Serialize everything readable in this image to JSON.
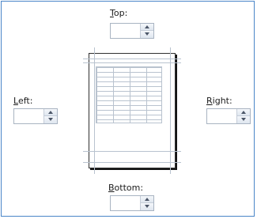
{
  "margins": {
    "top": {
      "label": "Top:",
      "accel": "T",
      "rest": "op:",
      "value": ""
    },
    "left": {
      "label": "Left:",
      "accel": "L",
      "rest": "eft:",
      "value": ""
    },
    "right": {
      "label": "Right:",
      "accel": "R",
      "rest": "ight:",
      "value": ""
    },
    "bottom": {
      "label": "Bottom:",
      "accel": "B",
      "rest": "ottom:",
      "value": ""
    }
  },
  "colors": {
    "frame_border": "#4a86c8",
    "page_border": "#303030",
    "guide_lines": "#b9c3cf"
  },
  "icons": {
    "spin_up": "triangle-up",
    "spin_down": "triangle-down"
  }
}
